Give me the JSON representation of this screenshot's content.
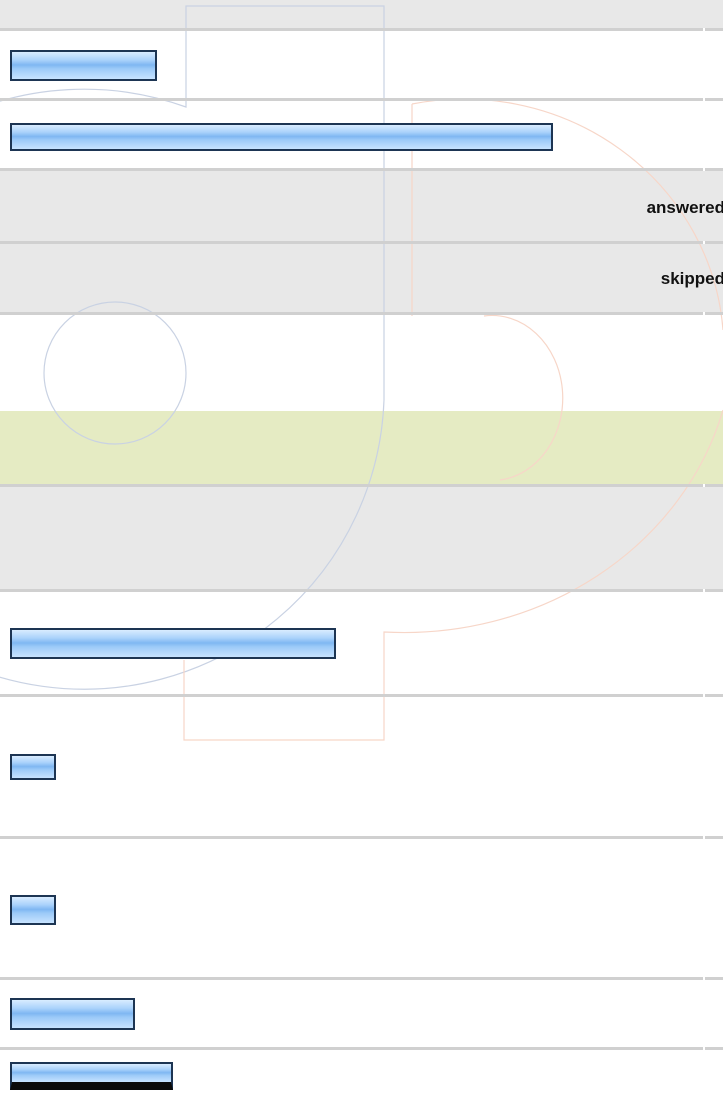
{
  "summary": {
    "answered_label": "answered",
    "skipped_label": "skipped"
  },
  "bars": [
    {
      "id": "bar-1",
      "fraction": 0.27
    },
    {
      "id": "bar-2",
      "fraction": 1.0
    },
    {
      "id": "bar-3",
      "fraction": 0.6
    },
    {
      "id": "bar-4",
      "fraction": 0.08
    },
    {
      "id": "bar-5",
      "fraction": 0.08
    },
    {
      "id": "bar-6",
      "fraction": 0.23
    },
    {
      "id": "bar-7",
      "fraction": 0.3
    }
  ],
  "colors": {
    "bar_border": "#1d3553",
    "bar_fill": "#9ccaf8",
    "row_gray": "#e8e8e8",
    "row_highlight": "#e5ebc3",
    "divider": "#d0d0d0"
  }
}
